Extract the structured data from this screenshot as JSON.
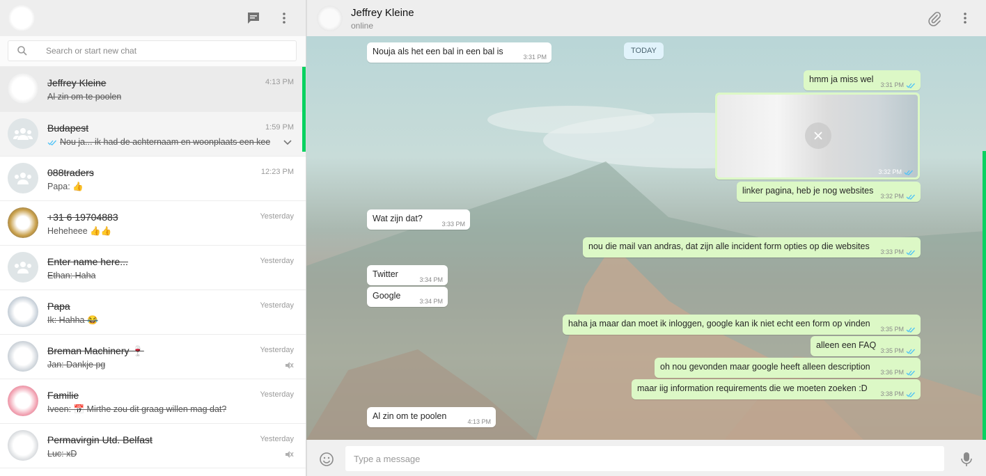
{
  "left": {
    "search_placeholder": "Search or start new chat",
    "chats": [
      {
        "name": "Jeffrey Kleine",
        "time": "4:13 PM",
        "preview": "Al zin om te poolen"
      },
      {
        "name": "Budapest",
        "time": "1:59 PM",
        "preview": "Nou ja... ik had de achternaam en woonplaats een kee"
      },
      {
        "name": "088traders",
        "time": "12:23 PM",
        "preview": "Papa: 👍"
      },
      {
        "name": "+31 6 19704883",
        "time": "Yesterday",
        "preview": "Heheheee 👍👍"
      },
      {
        "name": "Enter name here...",
        "time": "Yesterday",
        "preview": "Ethan: Haha"
      },
      {
        "name": "Papa",
        "time": "Yesterday",
        "preview": "Ik: Hahha 😂"
      },
      {
        "name": "Breman Machinery 🍷",
        "time": "Yesterday",
        "preview": "Jan: Dankje pg"
      },
      {
        "name": "Familie",
        "time": "Yesterday",
        "preview": "Iveen: 📅 Mirthe zou dit graag willen mag dat?"
      },
      {
        "name": "Permavirgin Utd. Belfast",
        "time": "Yesterday",
        "preview": "Luc: xD"
      }
    ]
  },
  "conversation": {
    "title": "Jeffrey Kleine",
    "status": "online",
    "today_label": "TODAY",
    "messages": [
      {
        "text": "Nouja als het een bal in een bal is",
        "time": "3:31 PM"
      },
      {
        "text": "hmm ja miss wel",
        "time": "3:31 PM"
      },
      {
        "text": "",
        "time": "3:32 PM"
      },
      {
        "text": "linker pagina, heb je nog websites",
        "time": "3:32 PM"
      },
      {
        "text": "Wat zijn dat?",
        "time": "3:33 PM"
      },
      {
        "text": "nou die mail van andras, dat zijn alle incident form opties op die websites",
        "time": "3:33 PM"
      },
      {
        "text": "Twitter",
        "time": "3:34 PM"
      },
      {
        "text": "Google",
        "time": "3:34 PM"
      },
      {
        "text": "haha ja maar dan moet ik inloggen, google kan ik niet echt een form op vinden",
        "time": "3:35 PM"
      },
      {
        "text": "alleen een FAQ",
        "time": "3:35 PM"
      },
      {
        "text": "oh nou gevonden maar google heeft alleen description",
        "time": "3:36 PM"
      },
      {
        "text": "maar iig information requirements die we moeten zoeken :D",
        "time": "3:38 PM"
      },
      {
        "text": "Al zin om te poolen",
        "time": "4:13 PM"
      }
    ],
    "composer_placeholder": "Type a message"
  },
  "colors": {
    "outgoing_bubble": "#dcf8c6",
    "incoming_bubble": "#ffffff",
    "accent_green": "#09d261",
    "read_tick": "#4fc3f7"
  },
  "icons": [
    "new-chat-icon",
    "menu-dots-icon",
    "search-icon",
    "group-icon",
    "mute-icon",
    "chevron-down-icon",
    "attach-icon",
    "emoji-icon",
    "mic-icon",
    "close-icon",
    "double-tick-icon"
  ]
}
